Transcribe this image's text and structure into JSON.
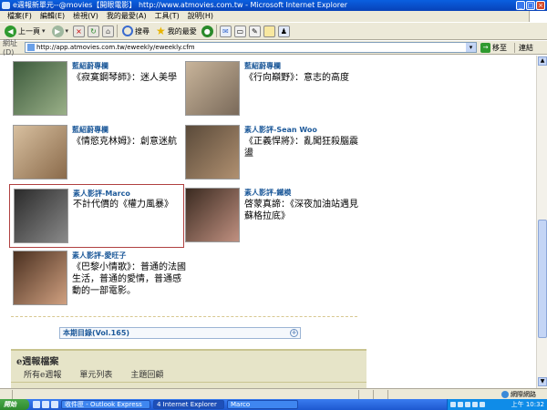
{
  "window": {
    "title": "e週報新單元--@movies【開眼電影】 http://www.atmovies.com.tw - Microsoft Internet Explorer"
  },
  "menu": [
    "檔案(F)",
    "編輯(E)",
    "檢視(V)",
    "我的最愛(A)",
    "工具(T)",
    "說明(H)"
  ],
  "toolbar": {
    "back_label": "上一頁",
    "search_label": "搜尋",
    "favorites_label": "我的最愛"
  },
  "address": {
    "label": "網址(D)",
    "url": "http://app.atmovies.com.tw/eweekly/eweekly.cfm",
    "go_label": "移至",
    "links_label": "連結"
  },
  "cards": [
    {
      "category": "藍紹蔚專欄",
      "description": "《寂寞鋼琴師》：迷人美學",
      "thumb_colors": [
        "#3c5a3c",
        "#9ab088"
      ]
    },
    {
      "category": "藍紹蔚專欄",
      "description": "《行向巔野》：意志的高度",
      "thumb_colors": [
        "#c8b49a",
        "#7a6a5a"
      ]
    },
    {
      "category": "藍紹蔚專欄",
      "description": "《情慾克林姆》：創意迷航",
      "thumb_colors": [
        "#d8c0a0",
        "#8a6a4a"
      ]
    },
    {
      "category": "素人影評-Sean Woo",
      "description": "《正義悍將》：亂闖狂殺腦震盪",
      "thumb_colors": [
        "#5a4a3a",
        "#b09070"
      ]
    },
    {
      "category": "素人影評-Marco",
      "description": "不計代價的《權力風暴》",
      "thumb_colors": [
        "#2a2a2a",
        "#8a8a8a"
      ]
    },
    {
      "category": "素人影評-鐵模",
      "description": "啓蒙真諦：《深夜加油站遇見蘇格拉底》",
      "thumb_colors": [
        "#3a2a20",
        "#c09080"
      ]
    },
    {
      "category": "素人影評-愛旺子",
      "description": "《巴黎小情歌》：普通的法國生活，普通的愛情，普通感動的一部電影。",
      "thumb_colors": [
        "#4a3020",
        "#d0a080"
      ]
    }
  ],
  "toc": {
    "label": "本期目錄(Vol.165)"
  },
  "archive": {
    "title": "e週報檔案",
    "tabs": [
      "所有e週報",
      "單元列表",
      "主題回顧"
    ]
  },
  "status": {
    "zone": "網際網路"
  },
  "taskbar": {
    "start": "開始",
    "tasks": [
      "收件匣 - Outlook Express",
      "4 Internet Explorer",
      "Marco"
    ],
    "clock": "上午 10:32"
  }
}
